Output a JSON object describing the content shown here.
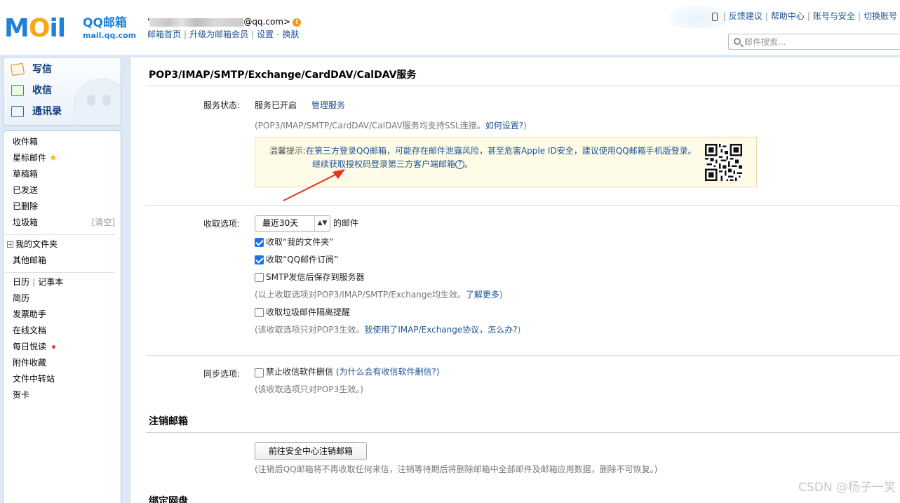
{
  "logo": {
    "word_m": "M",
    "word_o": "O",
    "word_il": "il",
    "name": "QQ邮箱",
    "domain": "mail.qq.com"
  },
  "account": {
    "first_char": "'",
    "email_suffix": "@qq.com>",
    "warn_mark": "!",
    "links": [
      "邮箱首页",
      "升级为邮箱会员",
      "设置",
      "换肤"
    ],
    "link_dash": "-"
  },
  "toplinks": [
    "反馈建议",
    "帮助中心",
    "账号与安全",
    "切换账号"
  ],
  "search": {
    "placeholder": "邮件搜索..."
  },
  "quick": [
    "写信",
    "收信",
    "通讯录"
  ],
  "folders": {
    "inbox": "收件箱",
    "starred": "星标邮件",
    "starred_icon": "★",
    "drafts": "草稿箱",
    "sent": "已发送",
    "deleted": "已删除",
    "spam": "垃圾箱",
    "spam_action": "[清空]",
    "my_folders": "我的文件夹",
    "plus_sign": "+",
    "other_mail": "其他邮箱",
    "calendar": "日历",
    "notebook": "记事本",
    "resume": "简历",
    "invoice": "发票助手",
    "docs": "在线文档",
    "daily": "每日悦读",
    "attachments": "附件收藏",
    "transfer": "文件中转站",
    "cards": "贺卡"
  },
  "main": {
    "title": "POP3/IMAP/SMTP/Exchange/CardDAV/CalDAV服务",
    "status_label": "服务状态:",
    "status_value": "服务已开启",
    "manage_link": "管理服务",
    "ssl_note": "(POP3/IMAP/SMTP/CardDAV/CalDAV服务均支持SSL连接。",
    "ssl_link": "如何设置?",
    "ssl_close": ")",
    "tip_label": "温馨提示:",
    "tip_text": "在第三方登录QQ邮箱，可能存在邮件泄露风险，甚至危害Apple ID安全，建议使用QQ邮箱手机版登录。",
    "tip_link": "继续获取授权码登录第三方客户端邮箱",
    "tip_help": "?",
    "tip_end": "。",
    "fetch_label": "收取选项:",
    "fetch_select": "最近30天",
    "select_arrow": "▲▼",
    "fetch_suffix": "的邮件",
    "opt_my_folders": "收取“我的文件夹”",
    "opt_subscriptions": "收取“QQ邮件订阅”",
    "opt_smtp_save": "SMTP发信后保存到服务器",
    "fetch_note": "(以上收取选项对POP3/IMAP/SMTP/Exchange均生效。",
    "fetch_note_link": "了解更多",
    "fetch_note_close": ")",
    "opt_spam": "收取垃圾邮件隔离提醒",
    "spam_note": "(该收取选项只对POP3生效。",
    "spam_note_link": "我使用了IMAP/Exchange协议，怎么办?",
    "spam_note_close": ")",
    "sync_label": "同步选项:",
    "sync_option": "禁止收信软件删信",
    "sync_link": "(为什么会有收信软件删信?)",
    "sync_note": "(该收取选项只对POP3生效。)",
    "cancel_title": "注销邮箱",
    "cancel_button": "前往安全中心注销邮箱",
    "cancel_note": "(注销后QQ邮箱将不再收取任何来信，注销等待期后将删除邮箱中全部邮件及邮箱应用数据，删除不可恢复。)",
    "next_title": "绑定网盘"
  },
  "watermark": "CSDN @杨子一笑",
  "colors": {
    "brand_blue": "#1f80d9",
    "link": "#1e5494",
    "tip_bg": "#fefbe7",
    "arrow_red": "#e8331f"
  }
}
